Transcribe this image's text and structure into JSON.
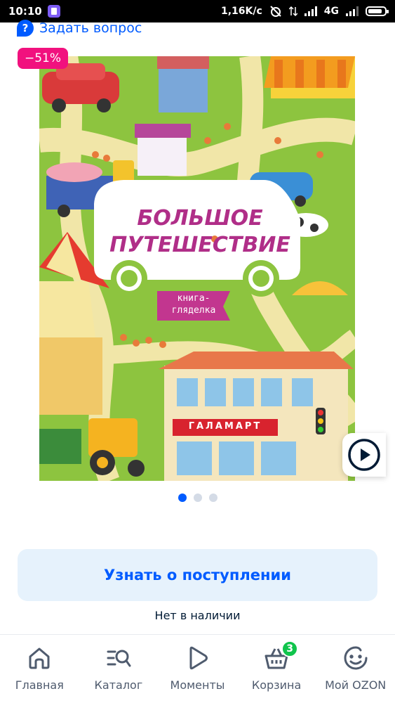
{
  "status_bar": {
    "time": "10:10",
    "network_speed": "1,16K/c",
    "network_type": "4G"
  },
  "ask_question": {
    "icon": "question-bubble-icon",
    "label": "Задать вопрос"
  },
  "product": {
    "discount_badge": "−51%",
    "image_carousel": {
      "dot_count": 3,
      "active_dot": 0
    },
    "cover": {
      "title_line1": "БОЛЬШОЕ",
      "title_line2": "ПУТЕШЕСТВИЕ",
      "subtitle_line1": "книга-",
      "subtitle_line2": "гляделка",
      "shop_sign": "ГАЛАМАРТ"
    },
    "notify_button_label": "Узнать о поступлении",
    "stock_status": "Нет в наличии"
  },
  "bottom_nav": {
    "items": [
      {
        "label": "Главная",
        "icon": "home-icon"
      },
      {
        "label": "Каталог",
        "icon": "catalog-search-icon"
      },
      {
        "label": "Моменты",
        "icon": "play-icon"
      },
      {
        "label": "Корзина",
        "icon": "cart-icon",
        "badge": "3"
      },
      {
        "label": "Мой OZON",
        "icon": "smiley-icon"
      }
    ]
  },
  "colors": {
    "accent": "#005bff",
    "discount": "#f1117e",
    "badge_green": "#10c44c"
  }
}
